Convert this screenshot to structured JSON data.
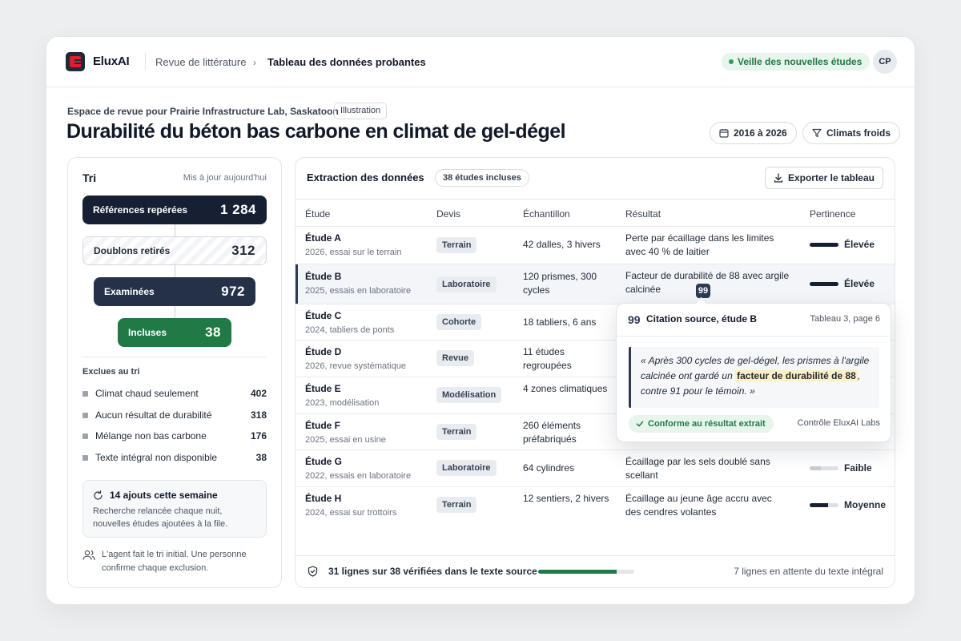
{
  "app": {
    "brand": "EluxAI"
  },
  "breadcrumb": {
    "parent": "Revue de littérature",
    "separator": "›",
    "current": "Tableau des données probantes"
  },
  "header": {
    "watch_label": "Veille des nouvelles études",
    "avatar_initials": "CP"
  },
  "page": {
    "workspace": "Espace de revue pour Prairie Infrastructure Lab, Saskatoon",
    "badge": "Illustration",
    "title": "Durabilité du béton bas carbone en climat de gel-dégel",
    "filters": {
      "years": "2016 à 2026",
      "climate": "Climats froids"
    }
  },
  "triage": {
    "title": "Tri",
    "updated": "Mis à jour aujourd'hui",
    "funnel": [
      {
        "label": "Références repérées",
        "count": "1 284"
      },
      {
        "label": "Doublons retirés",
        "count": "312"
      },
      {
        "label": "Examinées",
        "count": "972"
      },
      {
        "label": "Incluses",
        "count": "38"
      }
    ],
    "exclusions_title": "Exclues au tri",
    "exclusions": [
      {
        "label": "Climat chaud seulement",
        "count": "402"
      },
      {
        "label": "Aucun résultat de durabilité",
        "count": "318"
      },
      {
        "label": "Mélange non bas carbone",
        "count": "176"
      },
      {
        "label": "Texte intégral non disponible",
        "count": "38"
      }
    ],
    "weekly": {
      "title": "14 ajouts cette semaine",
      "text": "Recherche relancée chaque nuit, nouvelles études ajoutées à la file."
    },
    "agent_note": "L'agent fait le tri initial. Une personne confirme chaque exclusion."
  },
  "extraction": {
    "title": "Extraction des données",
    "count_badge": "38 études incluses",
    "export_label": "Exporter le tableau",
    "columns": [
      "Étude",
      "Devis",
      "Échantillon",
      "Résultat",
      "Pertinence"
    ],
    "rows": [
      {
        "name": "Étude A",
        "sub": "2026, essai sur le terrain",
        "design": "Terrain",
        "sample": "42 dalles, 3 hivers",
        "result": "Perte par écaillage dans les limites avec 40 % de laitier",
        "relevance": "Élevée",
        "level": 1.0
      },
      {
        "name": "Étude B",
        "sub": "2025, essais en laboratoire",
        "design": "Laboratoire",
        "sample": "120 prismes, 300 cycles",
        "result": "Facteur de durabilité de 88 avec argile calcinée",
        "relevance": "Élevée",
        "level": 1.0
      },
      {
        "name": "Étude C",
        "sub": "2024, tabliers de ponts",
        "design": "Cohorte",
        "sample": "18 tabliers, 6 ans",
        "result": "",
        "relevance": "",
        "level": 0
      },
      {
        "name": "Étude D",
        "sub": "2026, revue systématique",
        "design": "Revue",
        "sample": "11 études regroupées",
        "result": "",
        "relevance": "",
        "level": 0
      },
      {
        "name": "Étude E",
        "sub": "2023, modélisation",
        "design": "Modélisation",
        "sample": "4 zones climatiques",
        "result": "",
        "relevance": "",
        "level": 0
      },
      {
        "name": "Étude F",
        "sub": "2025, essai en usine",
        "design": "Terrain",
        "sample": "260 éléments préfabriqués",
        "result": "",
        "relevance": "",
        "level": 0
      },
      {
        "name": "Étude G",
        "sub": "2022, essais en laboratoire",
        "design": "Laboratoire",
        "sample": "64 cylindres",
        "result": "Écaillage par les sels doublé sans scellant",
        "relevance": "Faible",
        "level": 0.4
      },
      {
        "name": "Étude H",
        "sub": "2024, essai sur trottoirs",
        "design": "Terrain",
        "sample": "12 sentiers, 2 hivers",
        "result": "Écaillage au jeune âge accru avec des cendres volantes",
        "relevance": "Moyenne",
        "level": 0.65
      }
    ],
    "quote_marker": "99",
    "footer": {
      "verified": "31 lignes sur 38 vérifiées dans le texte source",
      "progress": 0.816,
      "pending": "7 lignes en attente du texte intégral"
    }
  },
  "citation": {
    "icon": "99",
    "title": "Citation source, étude B",
    "ref": "Tableau 3, page 6",
    "quote_before": "« Après 300 cycles de gel-dégel, les prismes à l'argile calcinée ont gardé un ",
    "quote_highlight": "facteur de durabilité de 88",
    "quote_after": ", contre 91 pour le témoin. »",
    "status": "Conforme au résultat extrait",
    "control": "Contrôle EluxAI Labs"
  }
}
